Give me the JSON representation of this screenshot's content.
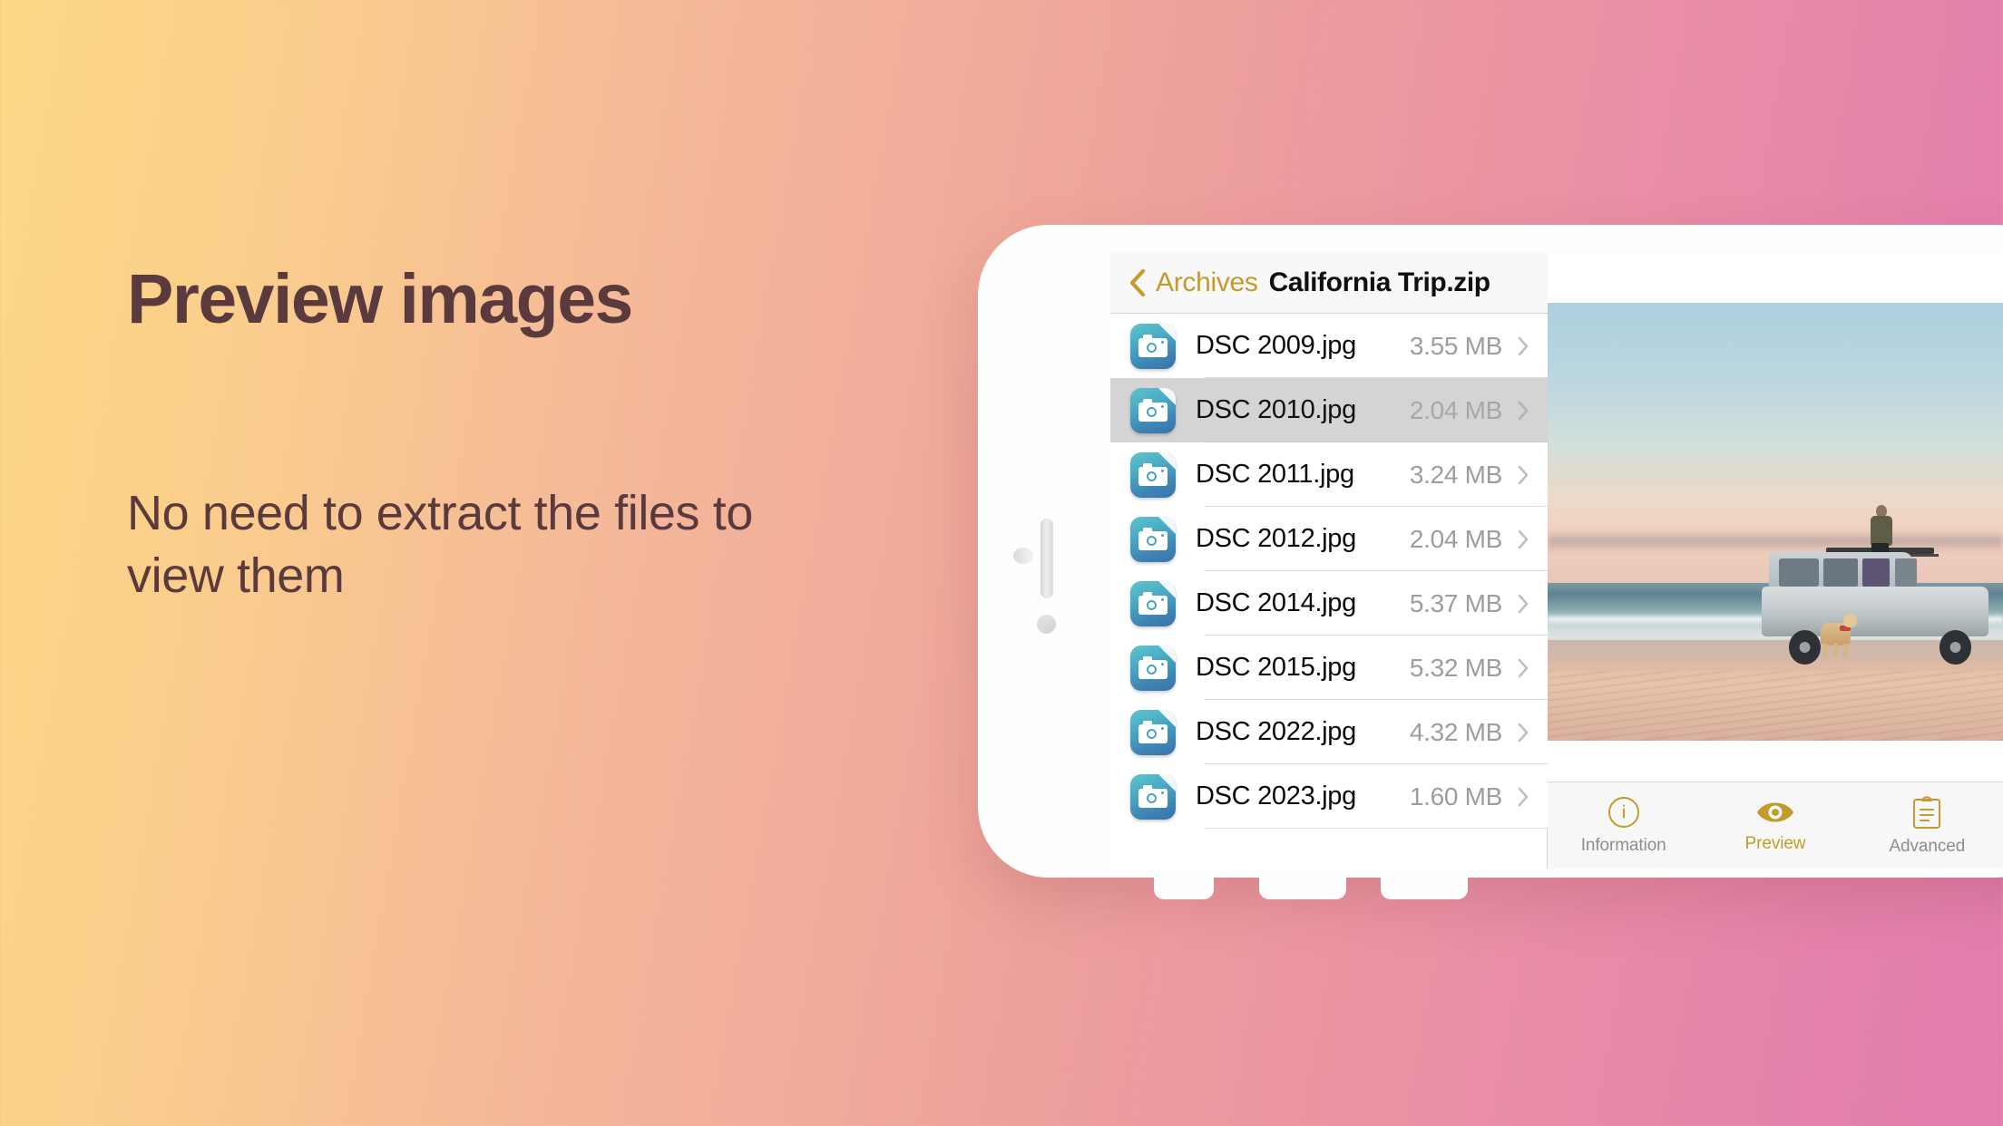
{
  "marketing": {
    "headline": "Preview images",
    "subheadline": "No need to extract the files to view them",
    "text_color": "#5A3A3C"
  },
  "background": {
    "gradient_start": "#FCD987",
    "gradient_mid": "#F0A99A",
    "gradient_end": "#E37DAE",
    "direction": "left-to-right"
  },
  "app": {
    "accent_color": "#C49A2C",
    "navbar": {
      "back_icon": "chevron-left-icon",
      "back_label": "Archives",
      "title": "California Trip.zip"
    },
    "files": [
      {
        "icon": "jpeg-photo-file-icon",
        "name": "DSC 2009.jpg",
        "size": "3.55 MB",
        "selected": false
      },
      {
        "icon": "jpeg-photo-file-icon",
        "name": "DSC 2010.jpg",
        "size": "2.04 MB",
        "selected": true
      },
      {
        "icon": "jpeg-photo-file-icon",
        "name": "DSC 2011.jpg",
        "size": "3.24 MB",
        "selected": false
      },
      {
        "icon": "jpeg-photo-file-icon",
        "name": "DSC 2012.jpg",
        "size": "2.04 MB",
        "selected": false
      },
      {
        "icon": "jpeg-photo-file-icon",
        "name": "DSC 2014.jpg",
        "size": "5.37 MB",
        "selected": false
      },
      {
        "icon": "jpeg-photo-file-icon",
        "name": "DSC 2015.jpg",
        "size": "5.32 MB",
        "selected": false
      },
      {
        "icon": "jpeg-photo-file-icon",
        "name": "DSC 2022.jpg",
        "size": "4.32 MB",
        "selected": false
      },
      {
        "icon": "jpeg-photo-file-icon",
        "name": "DSC 2023.jpg",
        "size": "1.60 MB",
        "selected": false
      }
    ],
    "preview": {
      "description": "Beach sunset photo: man sitting on the roof rack of a silver SUV with a golden retriever on the sand"
    },
    "tabs": [
      {
        "icon": "info-circle-icon",
        "label": "Information",
        "active": false
      },
      {
        "icon": "eye-icon",
        "label": "Preview",
        "active": true
      },
      {
        "icon": "clipboard-icon",
        "label": "Advanced",
        "active": false
      }
    ]
  }
}
